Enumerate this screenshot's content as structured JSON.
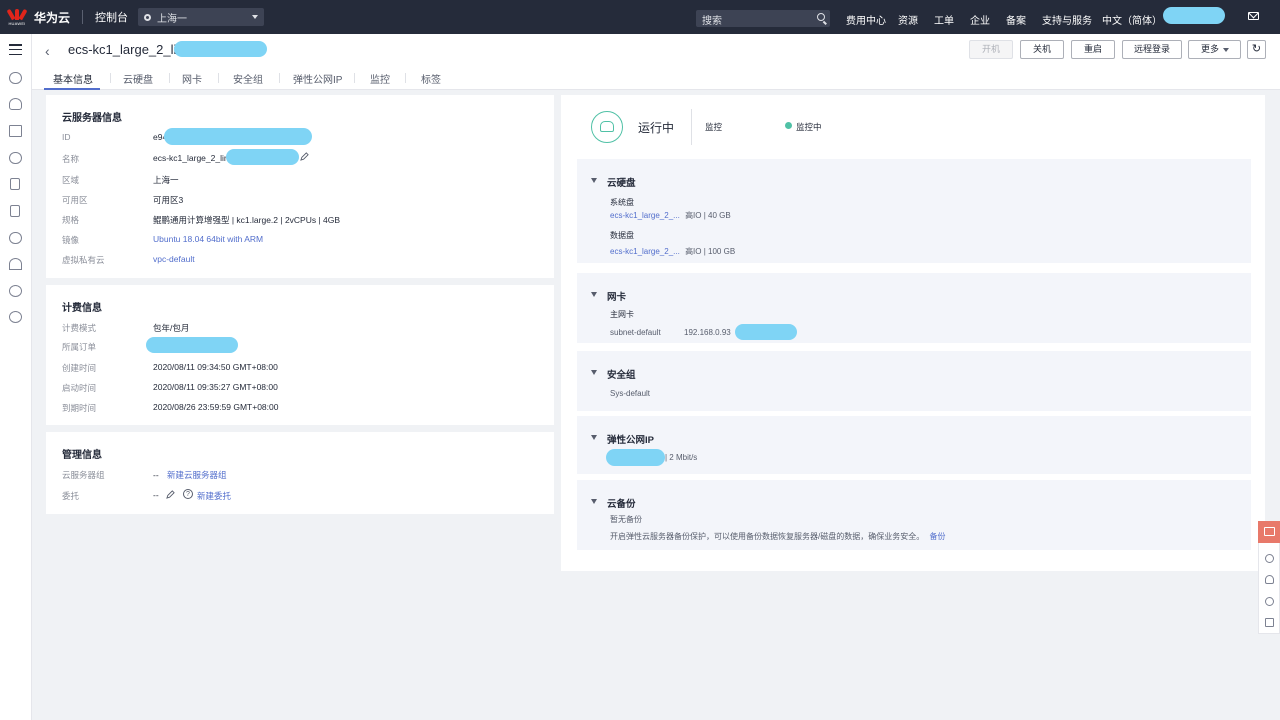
{
  "topbar": {
    "logo_text": "HUAWEI",
    "brand": "华为云",
    "console": "控制台",
    "region": "上海一",
    "search_placeholder": "搜索",
    "nav": [
      "费用中心",
      "资源",
      "工单",
      "企业",
      "备案",
      "支持与服务",
      "中文（简体）"
    ]
  },
  "sidebar": {
    "icons": [
      "menu-icon",
      "cloud-icon",
      "network-icon",
      "mountain-icon",
      "database-icon",
      "storage-icon",
      "server-icon",
      "cloud-outline-icon",
      "anchor-icon",
      "globe-icon",
      "ip-icon"
    ]
  },
  "header": {
    "title": "ecs-kc1_large_2_linux",
    "buttons": {
      "start": "开机",
      "stop": "关机",
      "restart": "重启",
      "remote": "远程登录",
      "more": "更多"
    }
  },
  "tabs": [
    "基本信息",
    "云硬盘",
    "网卡",
    "安全组",
    "弹性公网IP",
    "监控",
    "标签"
  ],
  "server_info": {
    "title": "云服务器信息",
    "rows": [
      {
        "label": "ID",
        "value": "e94"
      },
      {
        "label": "名称",
        "value": "ecs-kc1_large_2_linu"
      },
      {
        "label": "区域",
        "value": "上海一"
      },
      {
        "label": "可用区",
        "value": "可用区3"
      },
      {
        "label": "规格",
        "value": "鲲鹏通用计算增强型 | kc1.large.2 | 2vCPUs | 4GB"
      },
      {
        "label": "镜像",
        "value": "Ubuntu 18.04 64bit with ARM"
      },
      {
        "label": "虚拟私有云",
        "value": "vpc-default"
      }
    ]
  },
  "billing_info": {
    "title": "计费信息",
    "rows": [
      {
        "label": "计费模式",
        "value": "包年/包月"
      },
      {
        "label": "所属订单",
        "value": ""
      },
      {
        "label": "创建时间",
        "value": "2020/08/11 09:34:50 GMT+08:00"
      },
      {
        "label": "启动时间",
        "value": "2020/08/11 09:35:27 GMT+08:00"
      },
      {
        "label": "到期时间",
        "value": "2020/08/26 23:59:59 GMT+08:00"
      }
    ]
  },
  "mgmt_info": {
    "title": "管理信息",
    "group_label": "云服务器组",
    "group_dash": "--",
    "group_link": "新建云服务器组",
    "delegate_label": "委托",
    "delegate_dash": "--",
    "delegate_link": "新建委托"
  },
  "status": {
    "state": "运行中",
    "monitor_label": "监控",
    "monitor_value": "监控中",
    "monitor_color": "#50c1a6"
  },
  "disks": {
    "title": "云硬盘",
    "system_label": "系统盘",
    "system_name": "ecs-kc1_large_2_...",
    "system_spec": "高IO  |  40 GB",
    "data_label": "数据盘",
    "data_name": "ecs-kc1_large_2_...",
    "data_spec": "高IO  |  100 GB"
  },
  "nic": {
    "title": "网卡",
    "primary_label": "主网卡",
    "subnet": "subnet-default",
    "ip": "192.168.0.93"
  },
  "secgroup": {
    "title": "安全组",
    "name": "Sys-default"
  },
  "eip": {
    "title": "弹性公网IP",
    "bandwidth": "| 2 Mbit/s"
  },
  "backup": {
    "title": "云备份",
    "none": "暂无备份",
    "desc": "开启弹性云服务器备份保护，可以使用备份数据恢复服务器/磁盘的数据，确保业务安全。",
    "link": "备份"
  },
  "colors": {
    "topbar": "#252b3a",
    "link": "#526ecc",
    "redacted": "#7fd4f5",
    "float_accent": "#e8796a"
  }
}
